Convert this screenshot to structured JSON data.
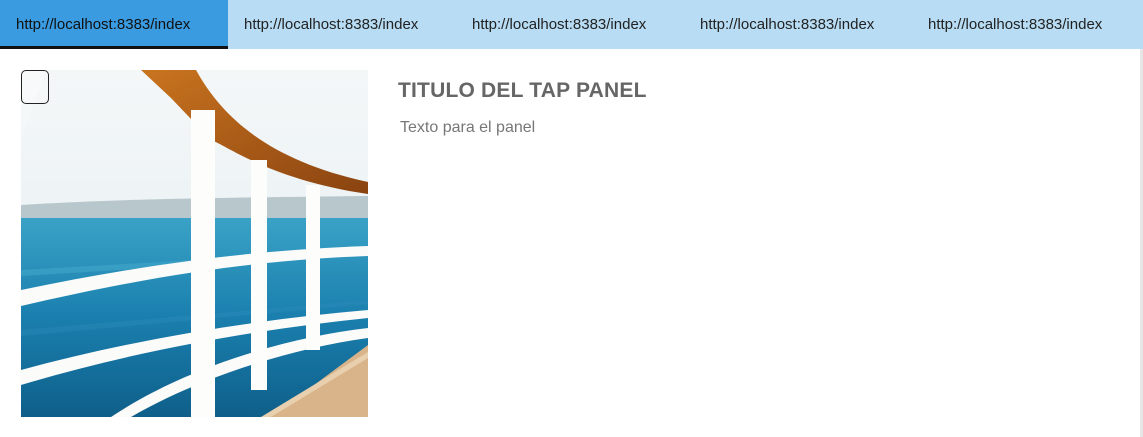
{
  "tabs": [
    {
      "label": "http://localhost:8383/index",
      "active": true
    },
    {
      "label": "http://localhost:8383/index",
      "active": false
    },
    {
      "label": "http://localhost:8383/index",
      "active": false
    },
    {
      "label": "http://localhost:8383/index",
      "active": false
    },
    {
      "label": "http://localhost:8383/index",
      "active": false
    }
  ],
  "panel": {
    "title": "TITULO DEL TAP PANEL",
    "text": "Texto para el panel",
    "image_subject": "ship railing over the sea"
  },
  "colors": {
    "tabbar_bg": "#b7dcf3",
    "tab_active_bg": "#3a9be0",
    "tab_active_underline": "#111111"
  }
}
